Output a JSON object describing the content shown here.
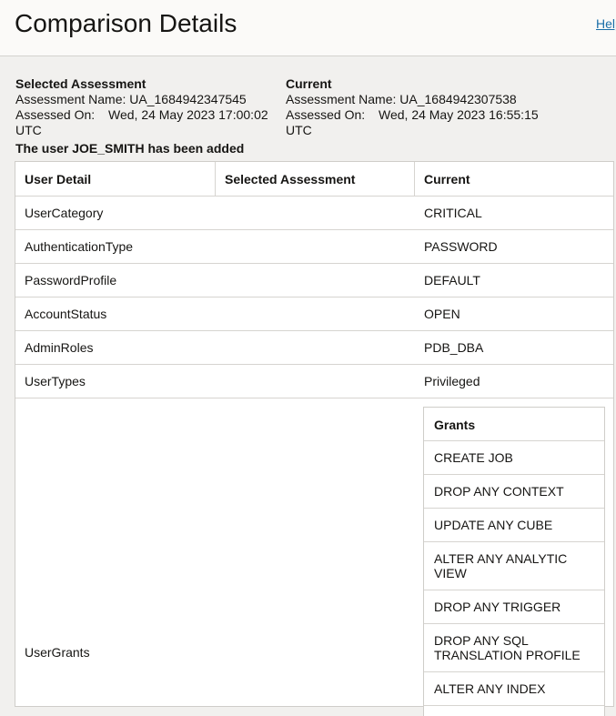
{
  "header": {
    "title": "Comparison Details",
    "help_label": "Help"
  },
  "selected": {
    "heading": "Selected Assessment",
    "name_label": "Assessment Name:",
    "name_value": "UA_1684942347545",
    "date_label": "Assessed On:",
    "date_value": "Wed, 24 May 2023 17:00:02",
    "tz": "UTC"
  },
  "current": {
    "heading": "Current",
    "name_label": "Assessment Name:",
    "name_value": "UA_1684942307538",
    "date_label": "Assessed On:",
    "date_value": "Wed, 24 May 2023 16:55:15",
    "tz": "UTC"
  },
  "message": "The user JOE_SMITH has been added",
  "table": {
    "headers": [
      "User Detail",
      "Selected Assessment",
      "Current"
    ],
    "rows": [
      {
        "detail": "UserCategory",
        "selected": "",
        "current": "CRITICAL"
      },
      {
        "detail": "AuthenticationType",
        "selected": "",
        "current": "PASSWORD"
      },
      {
        "detail": "PasswordProfile",
        "selected": "",
        "current": "DEFAULT"
      },
      {
        "detail": "AccountStatus",
        "selected": "",
        "current": "OPEN"
      },
      {
        "detail": "AdminRoles",
        "selected": "",
        "current": "PDB_DBA"
      },
      {
        "detail": "UserTypes",
        "selected": "",
        "current": "Privileged"
      },
      {
        "detail": "UserGrants",
        "selected": "",
        "current": ""
      }
    ]
  },
  "grants": {
    "header": "Grants",
    "items": [
      "CREATE JOB",
      "DROP ANY CONTEXT",
      "UPDATE ANY CUBE",
      "ALTER ANY ANALYTIC VIEW",
      "DROP ANY TRIGGER",
      "DROP ANY SQL TRANSLATION PROFILE",
      "ALTER ANY INDEX"
    ]
  }
}
